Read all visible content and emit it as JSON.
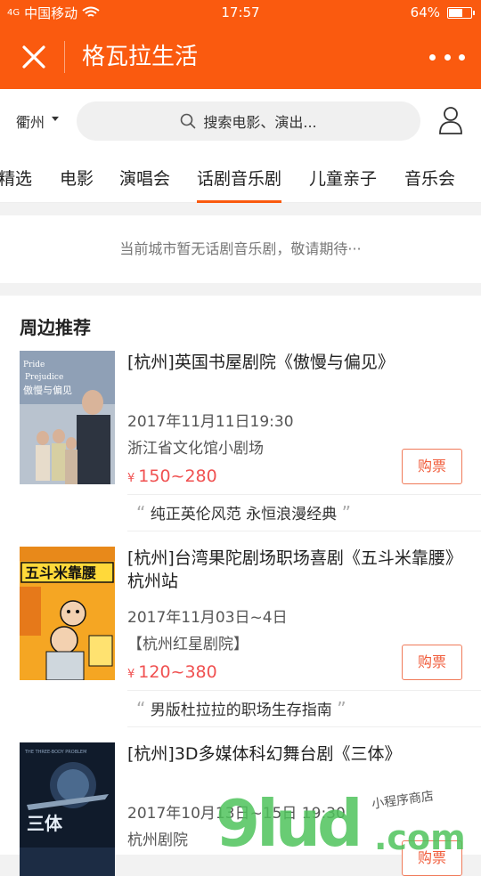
{
  "status": {
    "network": "4G",
    "carrier": "中国移动",
    "time": "17:57",
    "battery": "64%",
    "battery_level": 0.64
  },
  "navbar": {
    "title": "格瓦拉生活"
  },
  "search": {
    "city": "衢州",
    "placeholder": "搜索电影、演出..."
  },
  "tabs": [
    "精选",
    "电影",
    "演唱会",
    "话剧音乐剧",
    "儿童亲子",
    "音乐会"
  ],
  "active_tab": "话剧音乐剧",
  "empty_message": "当前城市暂无话剧音乐剧，敬请期待···",
  "recommend": {
    "title": "周边推荐",
    "items": [
      {
        "name": "[杭州]英国书屋剧院《傲慢与偏见》",
        "date": "2017年11月11日19:30",
        "venue": "浙江省文化馆小剧场",
        "currency": "¥",
        "price": "150~280",
        "buy": "购票",
        "quote": "纯正英伦风范  永恒浪漫经典",
        "poster_text": "Pride and Prejudice",
        "poster_cn": "傲慢与偏见"
      },
      {
        "name": "[杭州]台湾果陀剧场职场喜剧《五斗米靠腰》杭州站",
        "date": "2017年11月03日~4日",
        "venue": "【杭州红星剧院】",
        "currency": "¥",
        "price": "120~380",
        "buy": "购票",
        "quote": "男版杜拉拉的职场生存指南",
        "poster_cn": "五斗米靠腰"
      },
      {
        "name": "[杭州]3D多媒体科幻舞台剧《三体》",
        "date": "2017年10月13日~15日 19:30",
        "venue": "杭州剧院",
        "buy": "购票",
        "poster_text": "THE THREE-BODY PROBLEM",
        "poster_cn": "三体"
      }
    ]
  },
  "watermark": {
    "main": "9ludcom",
    "sub": "小程序商店"
  }
}
